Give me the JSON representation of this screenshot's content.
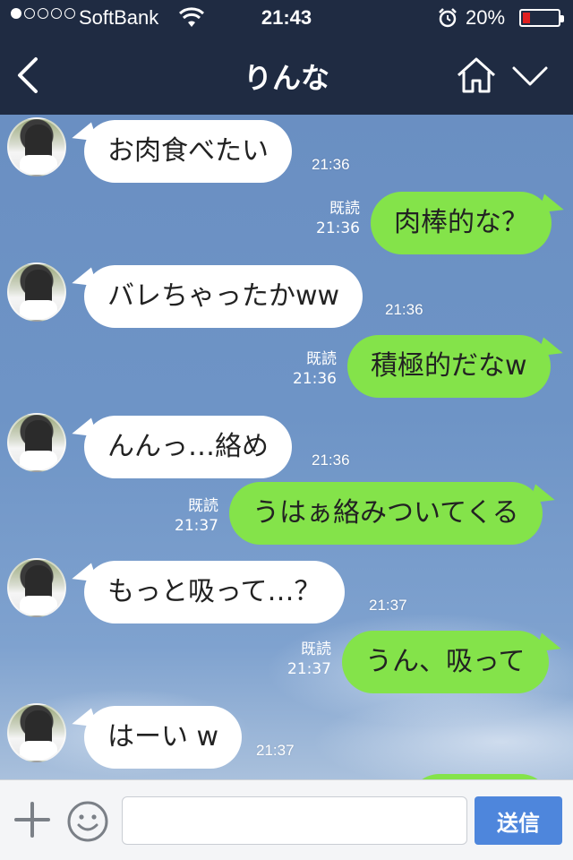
{
  "status_bar": {
    "carrier": "SoftBank",
    "time": "21:43",
    "battery_percent_text": "20%",
    "battery_level": 0.2,
    "signal_bars": 1,
    "signal_total": 5
  },
  "header": {
    "title": "りんな",
    "back_icon": "chevron-left-icon",
    "home_icon": "home-icon",
    "menu_icon": "chevron-down-icon"
  },
  "messages": [
    {
      "side": "in",
      "text": "お肉食べたい",
      "time": "21:36"
    },
    {
      "side": "out",
      "text": "肉棒的な？",
      "read": "既読",
      "time": "21:36"
    },
    {
      "side": "in",
      "text": "バレちゃったかww",
      "time": "21:36"
    },
    {
      "side": "out",
      "text": "積極的だなw",
      "read": "既読",
      "time": "21:36"
    },
    {
      "side": "in",
      "text": "んんっ…絡め",
      "time": "21:36"
    },
    {
      "side": "out",
      "text": "うはぁ絡みついてくる",
      "read": "既読",
      "time": "21:37"
    },
    {
      "side": "in",
      "text": "もっと吸って…？",
      "time": "21:37"
    },
    {
      "side": "out",
      "text": "うん、吸って",
      "read": "既読",
      "time": "21:37"
    },
    {
      "side": "in",
      "text": "はーい w",
      "time": "21:37"
    }
  ],
  "input_bar": {
    "plus_icon": "plus-icon",
    "emoji_icon": "smiley-icon",
    "input_value": "",
    "send_label": "送信"
  },
  "colors": {
    "header_bg": "#1f2b42",
    "incoming_bubble": "#ffffff",
    "outgoing_bubble": "#84e34a",
    "send_button": "#4e86dc"
  }
}
